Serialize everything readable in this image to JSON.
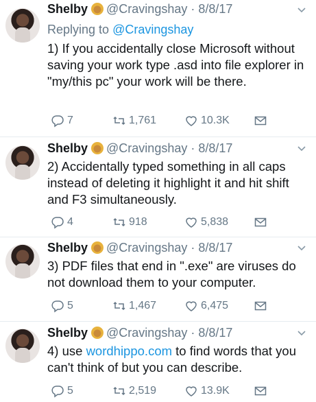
{
  "tweets": [
    {
      "author": "Shelby",
      "handle": "@Cravingshay",
      "date": "· 8/8/17",
      "reply_prefix": "Replying to ",
      "reply_to": "@Cravingshay",
      "text": "1) If you accidentally close Microsoft without saving your work type .asd into file explorer in \"my/this pc\" your work will be there.",
      "replies": "7",
      "retweets": "1,761",
      "likes": "10.3K"
    },
    {
      "author": "Shelby",
      "handle": "@Cravingshay",
      "date": "· 8/8/17",
      "text": "2) Accidentally typed something in all caps instead of deleting it highlight it and hit shift and F3 simultaneously.",
      "replies": "4",
      "retweets": "918",
      "likes": "5,838"
    },
    {
      "author": "Shelby",
      "handle": "@Cravingshay",
      "date": "· 8/8/17",
      "text": "3) PDF files that end in \".exe\" are viruses do not download them to your computer.",
      "replies": "5",
      "retweets": "1,467",
      "likes": "6,475"
    },
    {
      "author": "Shelby",
      "handle": "@Cravingshay",
      "date": "· 8/8/17",
      "text_before": "4) use ",
      "link": "wordhippo.com",
      "text_after": " to find words that you can't think of but you can describe.",
      "replies": "5",
      "retweets": "2,519",
      "likes": "13.9K"
    }
  ],
  "icons": {
    "reply": "reply-icon",
    "retweet": "retweet-icon",
    "like": "heart-icon",
    "message": "envelope-icon",
    "more": "chevron-down-icon",
    "badge": "emoji-icon"
  },
  "colors": {
    "text": "#14171a",
    "secondary": "#657786",
    "link": "#1b95e0",
    "divider": "#e6ecf0"
  }
}
